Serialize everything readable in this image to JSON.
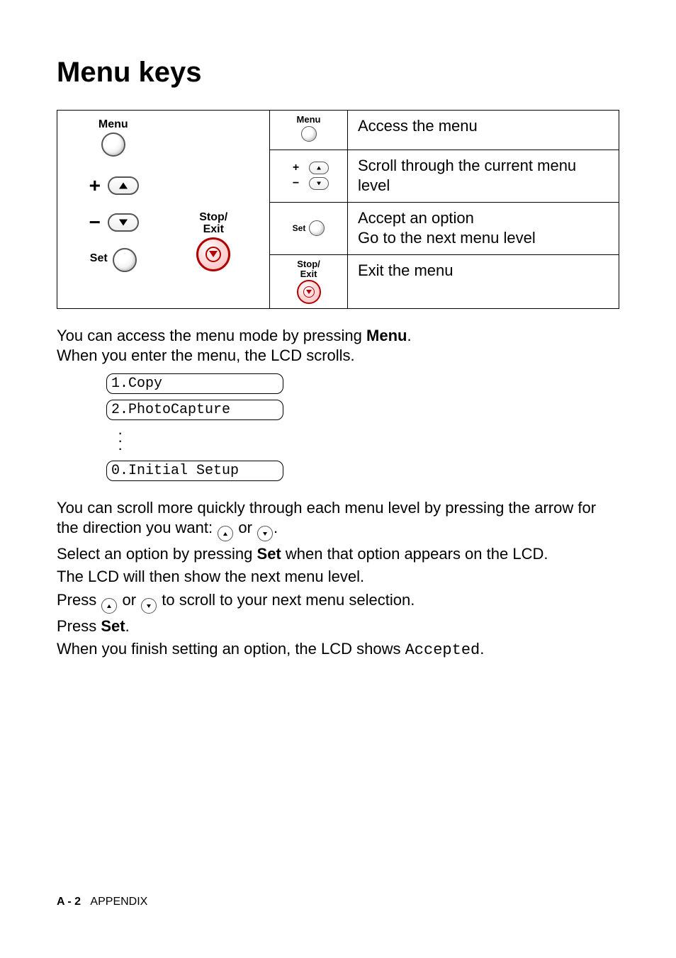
{
  "title": "Menu keys",
  "panel": {
    "menu_label": "Menu",
    "stop_label_line1": "Stop/",
    "stop_label_line2": "Exit",
    "set_label": "Set"
  },
  "rows": [
    {
      "icon_label": "Menu",
      "desc": "Access the menu"
    },
    {
      "desc": "Scroll through the current menu level"
    },
    {
      "icon_label": "Set",
      "desc_line1": "Accept an option",
      "desc_line2": "Go to the next menu level"
    },
    {
      "icon_label_line1": "Stop/",
      "icon_label_line2": "Exit",
      "desc": "Exit the menu"
    }
  ],
  "para1_a": "You can access the menu mode by pressing ",
  "para1_b": "Menu",
  "para1_c": ".",
  "para2": "When you enter the menu, the LCD scrolls.",
  "lcd": {
    "item1": "1.Copy",
    "item2": "2.PhotoCapture",
    "item3": "0.Initial Setup"
  },
  "para3_a": "You can scroll more quickly through each menu level by pressing the arrow for the direction you want: ",
  "para3_or": " or ",
  "para3_end": ".",
  "para4_a": "Select an option by pressing ",
  "para4_b": "Set",
  "para4_c": " when that option appears on the LCD.",
  "para5": "The LCD will then show the next menu level.",
  "para6_a": "Press ",
  "para6_or": " or ",
  "para6_b": " to scroll to your next menu selection.",
  "para7_a": "Press ",
  "para7_b": "Set",
  "para7_c": ".",
  "para8_a": "When you finish setting an option, the LCD shows ",
  "para8_b": "Accepted",
  "para8_c": ".",
  "footer": {
    "page": "A - 2",
    "section": "APPENDIX"
  }
}
